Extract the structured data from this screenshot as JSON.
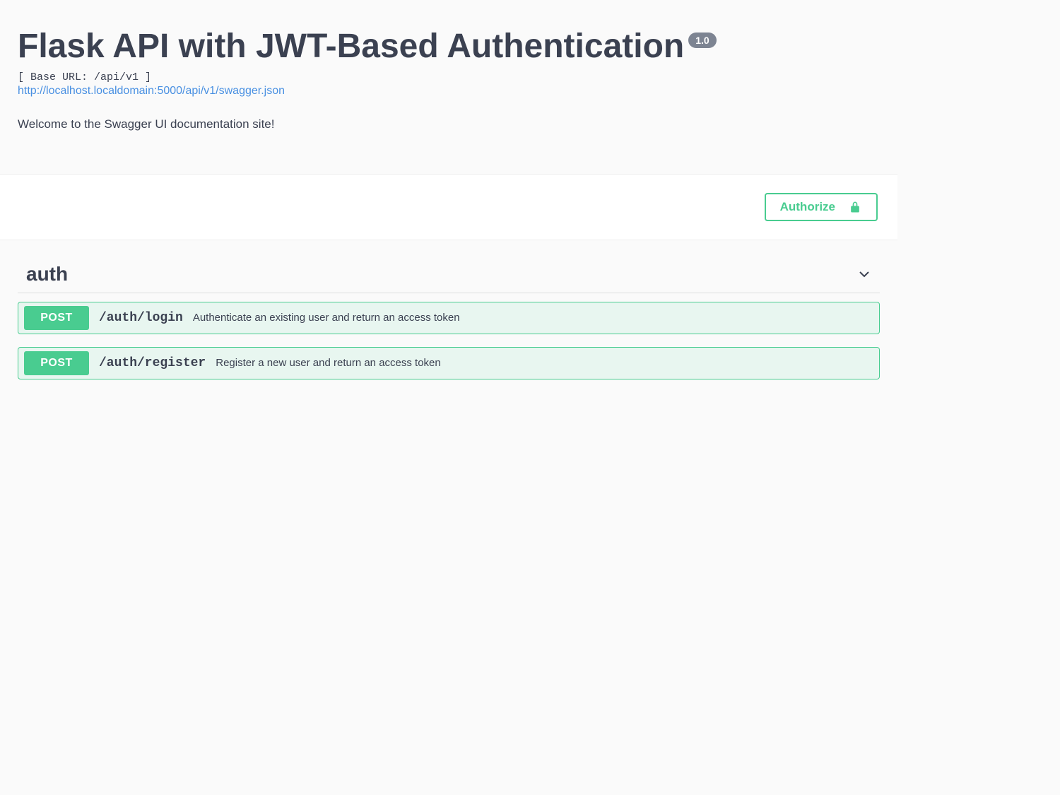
{
  "header": {
    "title": "Flask API with JWT-Based Authentication",
    "version": "1.0",
    "base_url_label": "[ Base URL: /api/v1 ]",
    "spec_url": "http://localhost.localdomain:5000/api/v1/swagger.json",
    "description": "Welcome to the Swagger UI documentation site!"
  },
  "authorize": {
    "label": "Authorize"
  },
  "tag": {
    "name": "auth"
  },
  "operations": [
    {
      "method": "POST",
      "path": "/auth/login",
      "summary": "Authenticate an existing user and return an access token"
    },
    {
      "method": "POST",
      "path": "/auth/register",
      "summary": "Register a new user and return an access token"
    }
  ]
}
